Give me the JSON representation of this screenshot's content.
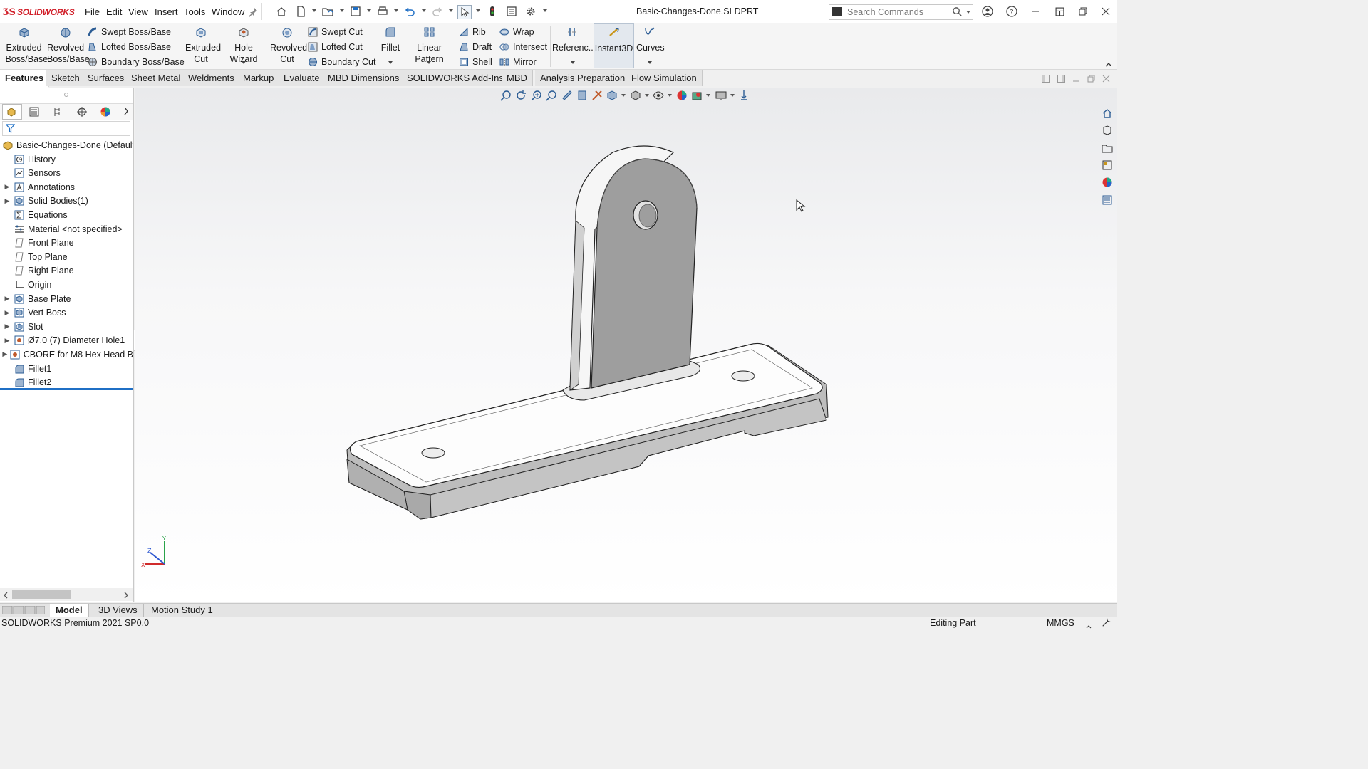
{
  "app": {
    "brand": "SOLIDWORKS",
    "document_title": "Basic-Changes-Done.SLDPRT"
  },
  "menu": [
    "File",
    "Edit",
    "View",
    "Insert",
    "Tools",
    "Window"
  ],
  "search": {
    "placeholder": "Search Commands"
  },
  "commands": {
    "extruded_boss": "Extruded Boss/Base",
    "revolved_boss": "Revolved Boss/Base",
    "swept_boss": "Swept Boss/Base",
    "lofted_boss": "Lofted Boss/Base",
    "boundary_boss": "Boundary Boss/Base",
    "extruded_cut": "Extruded Cut",
    "hole_wizard": "Hole Wizard",
    "revolved_cut": "Revolved Cut",
    "swept_cut": "Swept Cut",
    "lofted_cut": "Lofted Cut",
    "boundary_cut": "Boundary Cut",
    "fillet": "Fillet",
    "linear_pattern": "Linear Pattern",
    "rib": "Rib",
    "draft": "Draft",
    "shell": "Shell",
    "wrap": "Wrap",
    "intersect": "Intersect",
    "mirror": "Mirror",
    "reference": "Referenc...",
    "instant3d": "Instant3D",
    "curves": "Curves"
  },
  "tabs": [
    "Features",
    "Sketch",
    "Surfaces",
    "Sheet Metal",
    "Weldments",
    "Markup",
    "Evaluate",
    "MBD Dimensions",
    "SOLIDWORKS Add-Ins",
    "MBD",
    "Analysis Preparation",
    "Flow Simulation"
  ],
  "tree": {
    "root": "Basic-Changes-Done  (Default",
    "items": [
      {
        "label": "History",
        "expandable": false,
        "icon": "history-icon"
      },
      {
        "label": "Sensors",
        "expandable": false,
        "icon": "sensors-icon"
      },
      {
        "label": "Annotations",
        "expandable": true,
        "icon": "annotations-icon"
      },
      {
        "label": "Solid Bodies(1)",
        "expandable": true,
        "icon": "solid-bodies-icon"
      },
      {
        "label": "Equations",
        "expandable": false,
        "icon": "equations-icon"
      },
      {
        "label": "Material <not specified>",
        "expandable": false,
        "icon": "material-icon"
      },
      {
        "label": "Front Plane",
        "expandable": false,
        "icon": "plane-icon"
      },
      {
        "label": "Top Plane",
        "expandable": false,
        "icon": "plane-icon"
      },
      {
        "label": "Right Plane",
        "expandable": false,
        "icon": "plane-icon"
      },
      {
        "label": "Origin",
        "expandable": false,
        "icon": "origin-icon"
      },
      {
        "label": "Base Plate",
        "expandable": true,
        "icon": "extrude-feature-icon"
      },
      {
        "label": "Vert Boss",
        "expandable": true,
        "icon": "extrude-feature-icon"
      },
      {
        "label": "Slot",
        "expandable": true,
        "icon": "cut-feature-icon"
      },
      {
        "label": "Ø7.0 (7) Diameter Hole1",
        "expandable": true,
        "icon": "hole-feature-icon"
      },
      {
        "label": "CBORE for M8 Hex Head B",
        "expandable": true,
        "icon": "hole-feature-icon"
      },
      {
        "label": "Fillet1",
        "expandable": false,
        "icon": "fillet-feature-icon"
      },
      {
        "label": "Fillet2",
        "expandable": false,
        "icon": "fillet-feature-icon"
      }
    ]
  },
  "bottom_tabs": [
    "Model",
    "3D Views",
    "Motion Study 1"
  ],
  "status": {
    "left": "SOLIDWORKS Premium 2021 SP0.0",
    "mode": "Editing Part",
    "units": "MMGS"
  },
  "colors": {
    "brand_red": "#d1202a",
    "accent_blue": "#1f6fc5",
    "model_shade": "#a9a9a9"
  }
}
